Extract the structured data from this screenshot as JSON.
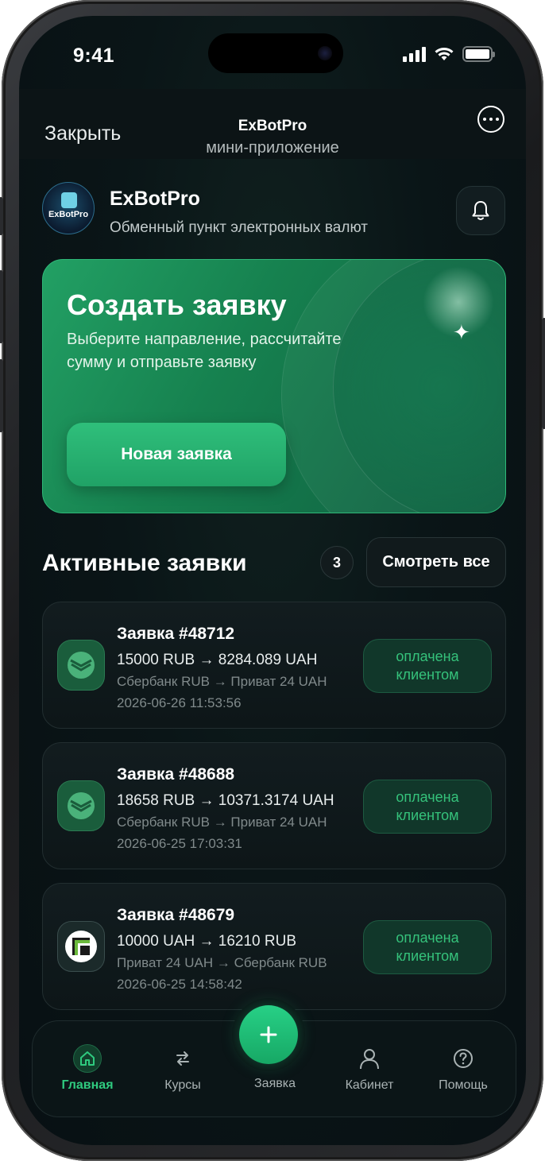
{
  "status_bar": {
    "time": "9:41"
  },
  "header": {
    "close_label": "Закрыть",
    "title": "ExBotPro",
    "subtitle": "мини-приложение"
  },
  "brand": {
    "logo_text": "ExBotPro",
    "name": "ExBotPro",
    "tagline": "Обменный пункт электронных валют"
  },
  "hero": {
    "title": "Создать заявку",
    "description": "Выберите направление, рассчитайте сумму и отправьте заявку",
    "button_label": "Новая заявка",
    "sparkle": "✦"
  },
  "active_orders": {
    "title": "Активные заявки",
    "count": "3",
    "see_all_label": "Смотреть все",
    "items": [
      {
        "title": "Заявка #48712",
        "amount": "15000 RUB → 8284.089 UAH",
        "route": "Сбербанк RUB → Приват 24 UAH",
        "date": "2026-06-26 11:53:56",
        "status": "оплачена клиентом",
        "icon": "sberbank-icon"
      },
      {
        "title": "Заявка #48688",
        "amount": "18658 RUB → 10371.3174 UAH",
        "route": "Сбербанк RUB → Приват 24 UAH",
        "date": "2026-06-25 17:03:31",
        "status": "оплачена клиентом",
        "icon": "sberbank-icon"
      },
      {
        "title": "Заявка #48679",
        "amount": "10000 UAH → 16210 RUB",
        "route": "Приват 24 UAH → Сбербанк RUB",
        "date": "2026-06-25 14:58:42",
        "status": "оплачена клиентом",
        "icon": "privat24-icon"
      }
    ]
  },
  "tabbar": {
    "home": "Главная",
    "rates": "Курсы",
    "order": "Заявка",
    "cabinet": "Кабинет",
    "help": "Помощь"
  },
  "colors": {
    "accent": "#2fca7f",
    "background": "#0a1517",
    "status_text": "#35c27b"
  }
}
